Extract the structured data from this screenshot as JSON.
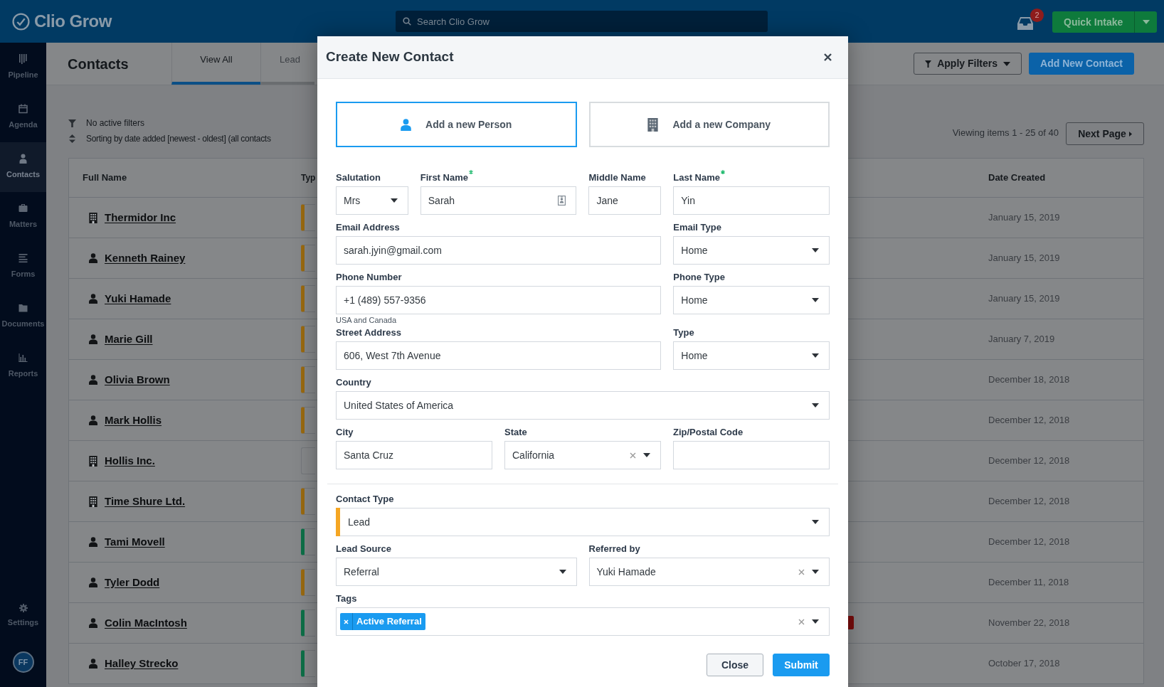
{
  "header": {
    "logo": "Clio Grow",
    "search": {
      "placeholder": "Search Clio Grow"
    },
    "notifications": {
      "count": "2"
    },
    "quick_intake": "Quick Intake"
  },
  "sidebar": {
    "items": [
      {
        "label": "Pipeline",
        "selected": false
      },
      {
        "label": "Agenda",
        "selected": false
      },
      {
        "label": "Contacts",
        "selected": true
      },
      {
        "label": "Matters",
        "selected": false
      },
      {
        "label": "Forms",
        "selected": false
      },
      {
        "label": "Documents",
        "selected": false
      },
      {
        "label": "Reports",
        "selected": false
      }
    ],
    "settings": "Settings",
    "avatar": "FF"
  },
  "page": {
    "title": "Contacts",
    "tabs": [
      {
        "label": "View All",
        "selected": true
      },
      {
        "label": "Lead",
        "selected": false
      }
    ],
    "apply_filters": "Apply Filters",
    "add_new_contact": "Add New Contact",
    "filter_status": "No active filters",
    "sort_status": "Sorting by date added [newest - oldest] (all contacts",
    "viewing": "Viewing items 1 - 25 of 40",
    "next_page": "Next Page"
  },
  "table": {
    "columns": [
      "Full Name",
      "Typ",
      "Date Created"
    ],
    "rows": [
      {
        "kind": "company",
        "name": "Thermidor Inc",
        "color": "#9a6a10",
        "date": "January 15, 2019"
      },
      {
        "kind": "person",
        "name": "Kenneth Rainey",
        "color": "#9a6a10",
        "date": "January 15, 2019"
      },
      {
        "kind": "person",
        "name": "Yuki Hamade",
        "color": "#9a6a10",
        "date": "January 15, 2019"
      },
      {
        "kind": "person",
        "name": "Marie Gill",
        "color": "#9a6a10",
        "date": "January 7, 2019"
      },
      {
        "kind": "person",
        "name": "Olivia Brown",
        "color": "#9a6a10",
        "date": "December 18, 2018"
      },
      {
        "kind": "person",
        "name": "Mark Hollis",
        "color": "#9a6a10",
        "date": "December 12, 2018"
      },
      {
        "kind": "company",
        "name": "Hollis Inc.",
        "date": "December 12, 2018"
      },
      {
        "kind": "company",
        "name": "Time Shure Ltd.",
        "color": "#9a6a10",
        "date": "December 12, 2018"
      },
      {
        "kind": "person",
        "name": "Tami Movell",
        "color": "#0d7048",
        "date": "December 12, 2018"
      },
      {
        "kind": "person",
        "name": "Tyler Dodd",
        "color": "#9a6a10",
        "date": "December 11, 2018"
      },
      {
        "kind": "person",
        "name": "Colin MacIntosh",
        "color": "#0d7048",
        "marker": {
          "color": "#7a0c0c"
        },
        "date": "November 22, 2018"
      },
      {
        "kind": "person",
        "name": "Halley Strecko",
        "color": "#0d7048",
        "date": "October 17, 2018"
      }
    ]
  },
  "modal": {
    "title": "Create New Contact",
    "contact_kinds": [
      {
        "label": "Add a new Person",
        "selected": true
      },
      {
        "label": "Add a new Company",
        "selected": false
      }
    ],
    "sections": [
      {
        "rows": [
          {
            "kind": "quad",
            "fields": [
              {
                "label": "Salutation",
                "kind": "select",
                "value": "Mrs"
              },
              {
                "label": "First Name",
                "required": true,
                "kind": "name",
                "value": "Sarah"
              },
              {
                "label": "Middle Name",
                "kind": "text",
                "value": "Jane"
              },
              {
                "label": "Last Name",
                "required": true,
                "kind": "text",
                "value": "Yin"
              }
            ]
          },
          {
            "kind": "wide",
            "fields": [
              {
                "label": "Email Address",
                "kind": "text",
                "value": "sarah.jyin@gmail.com"
              },
              {
                "label": "Email Type",
                "kind": "select",
                "value": "Home"
              }
            ]
          },
          {
            "kind": "wide",
            "fields": [
              {
                "label": "Phone Number",
                "kind": "text",
                "value": "+1 (489) 557-9356",
                "hint": "USA and Canada"
              },
              {
                "label": "Phone Type",
                "kind": "select",
                "value": "Home"
              }
            ]
          },
          {
            "kind": "wide",
            "fields": [
              {
                "label": "Street Address",
                "kind": "text",
                "value": "606, West 7th Avenue"
              },
              {
                "label": "Type",
                "kind": "select",
                "value": "Home"
              }
            ]
          },
          {
            "kind": "full",
            "fields": [
              {
                "label": "Country",
                "kind": "select",
                "value": "United States of America"
              }
            ]
          },
          {
            "kind": "thirds",
            "fields": [
              {
                "label": "City",
                "kind": "text",
                "value": "Santa Cruz"
              },
              {
                "label": "State",
                "kind": "select",
                "value": "California",
                "clearable": true
              },
              {
                "label": "Zip/Postal Code",
                "kind": "text"
              }
            ]
          }
        ]
      },
      {
        "rows": [
          {
            "kind": "full",
            "fields": [
              {
                "label": "Contact Type",
                "kind": "select",
                "value": "Lead",
                "color": "#f5a623"
              }
            ]
          },
          {
            "kind": "halves",
            "fields": [
              {
                "label": "Lead Source",
                "kind": "select",
                "value": "Referral"
              },
              {
                "label": "Referred by",
                "kind": "select",
                "value": "Yuki Hamade",
                "clearable": true
              }
            ]
          },
          {
            "kind": "full",
            "fields": [
              {
                "label": "Tags",
                "kind": "tags",
                "tags": [
                  "Active Referral"
                ],
                "clearable": true
              }
            ]
          }
        ]
      }
    ],
    "buttons": [
      {
        "label": "Close",
        "kind": "secondary"
      },
      {
        "label": "Submit",
        "kind": "primary"
      }
    ]
  }
}
